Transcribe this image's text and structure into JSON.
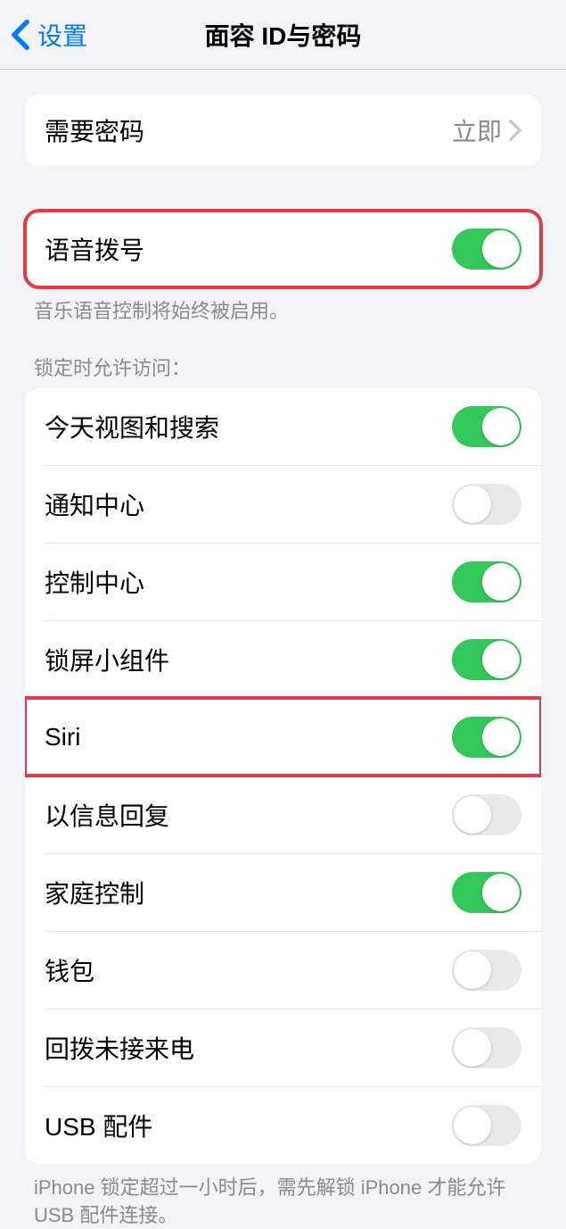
{
  "nav": {
    "back_label": "设置",
    "title": "面容 ID与密码"
  },
  "passcode_section": {
    "require_passcode_label": "需要密码",
    "require_passcode_value": "立即"
  },
  "voice_dial": {
    "label": "语音拨号",
    "on": true,
    "footer": "音乐语音控制将始终被启用。"
  },
  "allow_access": {
    "header": "锁定时允许访问：",
    "items": [
      {
        "label": "今天视图和搜索",
        "on": true
      },
      {
        "label": "通知中心",
        "on": false
      },
      {
        "label": "控制中心",
        "on": true
      },
      {
        "label": "锁屏小组件",
        "on": true
      },
      {
        "label": "Siri",
        "on": true,
        "highlighted": true
      },
      {
        "label": "以信息回复",
        "on": false
      },
      {
        "label": "家庭控制",
        "on": true
      },
      {
        "label": "钱包",
        "on": false
      },
      {
        "label": "回拨未接来电",
        "on": false
      },
      {
        "label": "USB 配件",
        "on": false
      }
    ],
    "footer": "iPhone 锁定超过一小时后，需先解锁 iPhone 才能允许 USB 配件连接。"
  }
}
